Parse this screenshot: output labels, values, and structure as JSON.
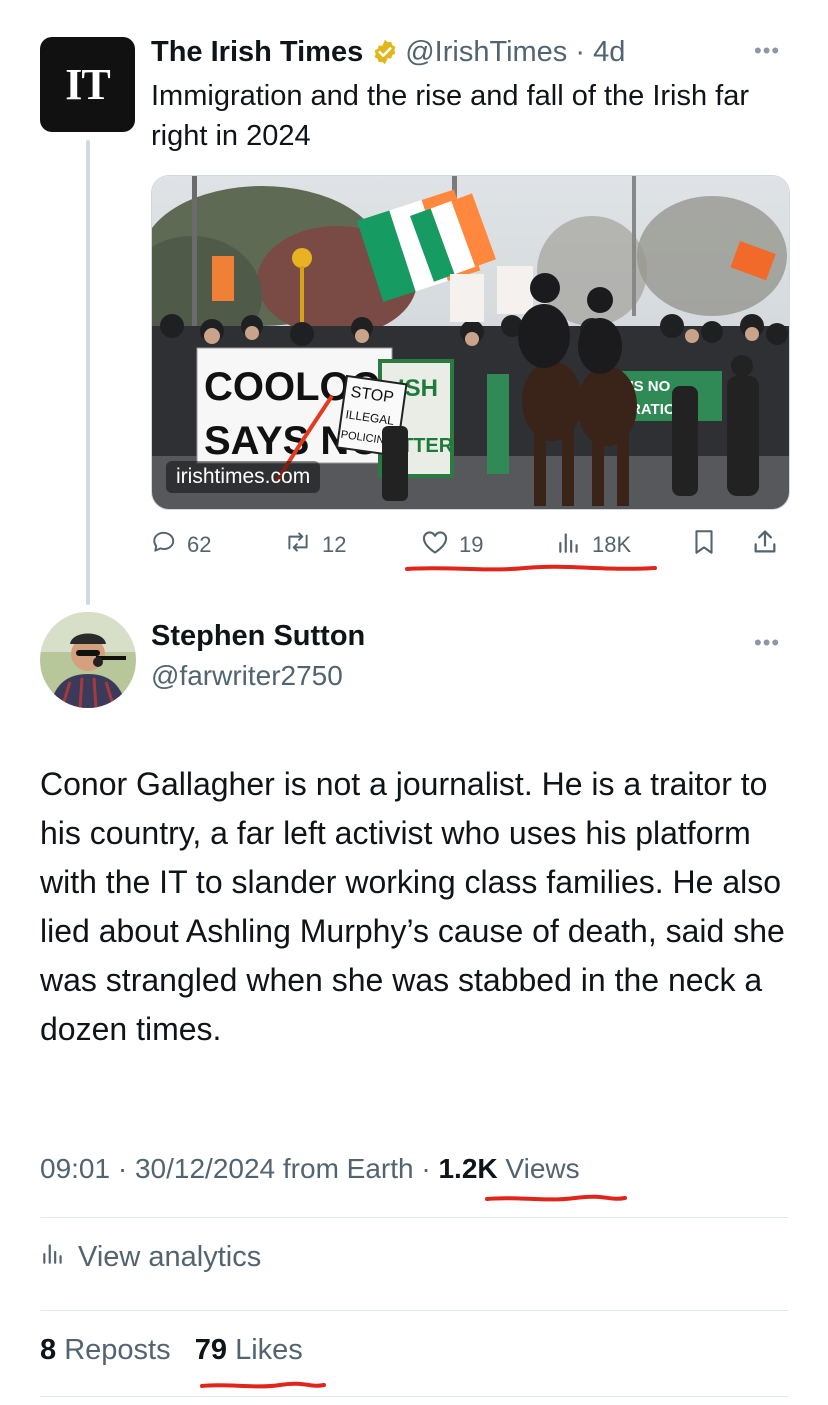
{
  "quoted_tweet": {
    "logo_text": "IT",
    "name": "The Irish Times",
    "handle": "@IrishTimes",
    "time": "4d",
    "text": "Immigration and the rise and fall of the Irish far right in 2024",
    "card": {
      "domain": "irishtimes.com",
      "banner_left": [
        "COOLOCK",
        "SAYS NO"
      ],
      "placard_stop": [
        "STOP",
        "ILLEGAL",
        "POLICING"
      ],
      "banner_right": [
        "'S NO",
        "RATION!"
      ]
    },
    "stats": {
      "replies": "62",
      "reposts": "12",
      "likes": "19",
      "views": "18K"
    },
    "icons": [
      "reply-icon",
      "repost-icon",
      "like-icon",
      "views-icon",
      "bookmark-icon",
      "share-icon"
    ]
  },
  "main_tweet": {
    "name": "Stephen Sutton",
    "handle": "@farwriter2750",
    "text": "Conor Gallagher is not a journalist. He is a traitor to his country, a far left activist who uses his platform with the IT to slander working class families. He also lied about Ashling Murphy’s cause of death, said she was strangled when she was stabbed in the neck a dozen times.",
    "meta": {
      "time": "09:01",
      "date": "30/12/2024",
      "source": "from Earth",
      "views_count": "1.2K",
      "views_label": "Views"
    },
    "view_analytics_label": "View analytics",
    "reposts_count": "8",
    "reposts_label": "Reposts",
    "likes_count": "79",
    "likes_label": "Likes"
  },
  "colors": {
    "text": "#0f1419",
    "muted": "#536471",
    "verified_gold": "#e2b719",
    "annotation_red": "#e0251b"
  }
}
